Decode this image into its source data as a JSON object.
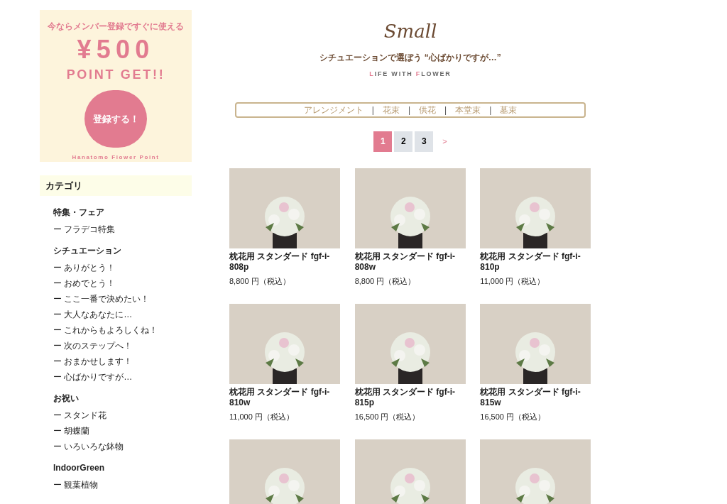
{
  "banner": {
    "lead": "今ならメンバー登録ですぐに使える",
    "amount": "¥500",
    "headline": "POINT GET!!",
    "button": "登録する！",
    "footer": "Hanatomo Flower Point"
  },
  "sidebar": {
    "title": "カテゴリ",
    "groups": [
      {
        "title": "特集・フェア",
        "items": [
          "ー フラデコ特集"
        ]
      },
      {
        "title": "シチュエーション",
        "items": [
          "ー ありがとう！",
          "ー おめでとう！",
          "ー ここ一番で決めたい！",
          "ー 大人なあなたに…",
          "ー これからもよろしくね！",
          "ー 次のステップへ！",
          "ー おまかせします！",
          "ー 心ばかりですが…"
        ]
      },
      {
        "title": "お祝い",
        "items": [
          "ー スタンド花",
          "ー 胡蝶蘭",
          "ー いろいろな鉢物"
        ]
      },
      {
        "title": "IndoorGreen",
        "items": [
          "ー 観葉植物"
        ]
      }
    ]
  },
  "header": {
    "title": "Small",
    "subtitle": "シチュエーションで選ぼう “心ばかりですが…”",
    "tagline": [
      {
        "text": "L",
        "accent": true
      },
      {
        "text": "IFE WITH ",
        "accent": false
      },
      {
        "text": "F",
        "accent": true
      },
      {
        "text": "LOWER",
        "accent": false
      }
    ]
  },
  "filters": [
    {
      "label": "アレンジメント"
    },
    {
      "label": "花束"
    },
    {
      "label": "供花"
    },
    {
      "label": "本堂束"
    },
    {
      "label": "墓束"
    }
  ],
  "filter_separator": "|",
  "pagination": {
    "pages": [
      {
        "label": "1",
        "selected": true
      },
      {
        "label": "2",
        "selected": false
      },
      {
        "label": "3",
        "selected": false
      }
    ],
    "next": ">"
  },
  "products": [
    {
      "kind": "card",
      "title": "枕花用 スタンダード fgf-i-808p",
      "price": "8,800 円（税込）"
    },
    {
      "kind": "card",
      "title": "枕花用 スタンダード fgf-i-808w",
      "price": "8,800 円（税込）"
    },
    {
      "kind": "card",
      "title": "枕花用 スタンダード fgf-i-810p",
      "price": "11,000 円（税込）"
    },
    {
      "kind": "card",
      "title": "枕花用 スタンダード fgf-i-810w",
      "price": "11,000 円（税込）"
    },
    {
      "kind": "card",
      "title": "枕花用 スタンダード fgf-i-815p",
      "price": "16,500 円（税込）"
    },
    {
      "kind": "card",
      "title": "枕花用 スタンダード fgf-i-815w",
      "price": "16,500 円（税込）"
    },
    {
      "kind": "photo"
    },
    {
      "kind": "photo"
    },
    {
      "kind": "photo"
    }
  ]
}
